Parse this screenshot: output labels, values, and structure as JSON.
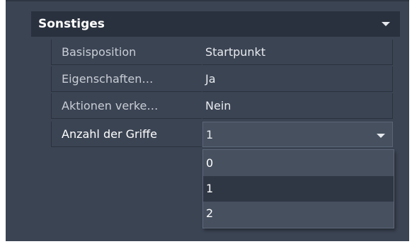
{
  "section": {
    "title": "Sonstiges"
  },
  "properties": [
    {
      "name": "Basisposition",
      "value": "Startpunkt"
    },
    {
      "name": "Eigenschaften…",
      "value": "Ja"
    },
    {
      "name": "Aktionen verke…",
      "value": "Nein"
    },
    {
      "name": "Anzahl der Griffe",
      "value": "1"
    }
  ],
  "dropdown": {
    "options": [
      "0",
      "1",
      "2"
    ],
    "selected": "1"
  },
  "colors": {
    "panel_bg": "#3b4453",
    "header_bg": "#2a313e",
    "dropdown_bg": "#46505f",
    "selected_option_bg": "#2f3644"
  }
}
